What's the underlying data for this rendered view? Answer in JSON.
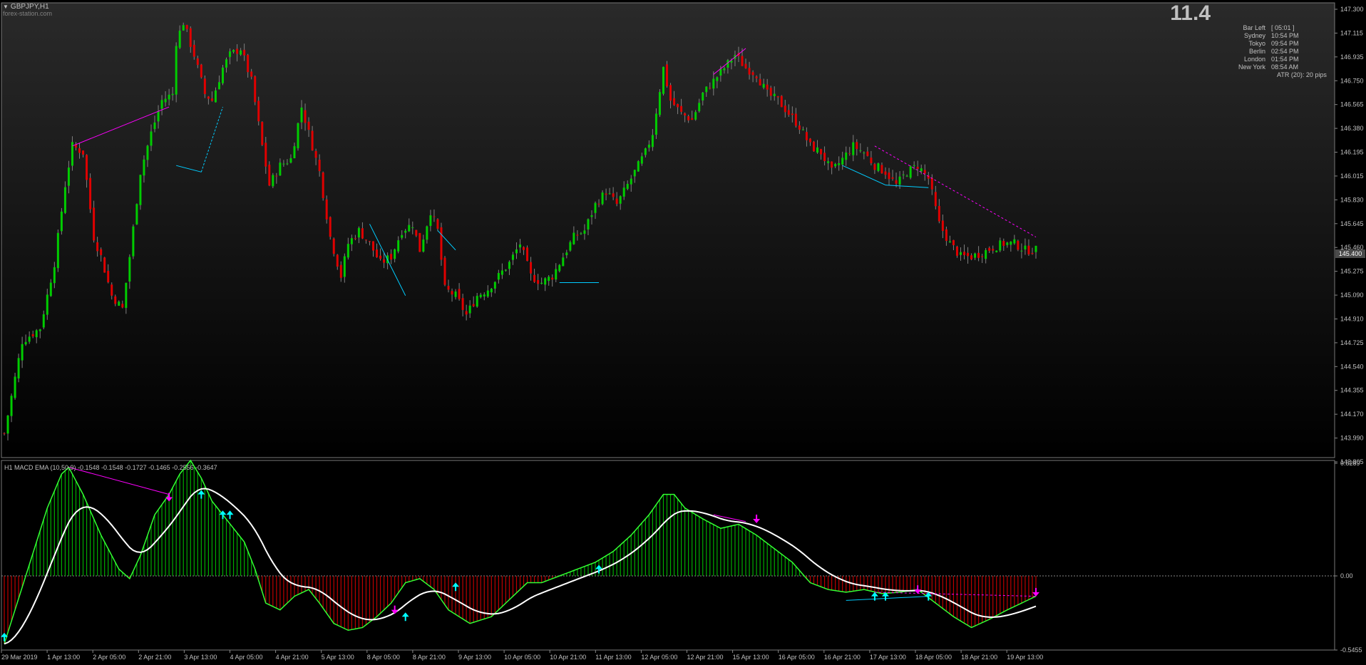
{
  "header": {
    "symbol": "GBPJPY,H1",
    "watermark": "forex-station.com",
    "dropdown_icon": "triangle-down-icon"
  },
  "timer": {
    "big_value": "11.4",
    "rows": [
      {
        "name": "Bar Left",
        "time": "[ 05:01 ]"
      },
      {
        "name": "Sydney",
        "time": "10:54 PM"
      },
      {
        "name": "Tokyo",
        "time": "09:54 PM"
      },
      {
        "name": "Berlin",
        "time": "02:54 PM"
      },
      {
        "name": "London",
        "time": "01:54 PM"
      },
      {
        "name": "New York",
        "time": "08:54 AM"
      }
    ],
    "atr": "ATR (20): 20 pips"
  },
  "price_axis": {
    "ticks": [
      "147.300",
      "147.115",
      "146.935",
      "146.750",
      "146.565",
      "146.380",
      "146.195",
      "146.015",
      "145.830",
      "145.645",
      "145.460",
      "145.275",
      "145.090",
      "144.910",
      "144.725",
      "144.540",
      "144.355",
      "144.170",
      "143.990",
      "143.805"
    ],
    "current_price": "145.400"
  },
  "macd": {
    "label": "H1 MACD EMA (10,50,9) -0.1548 -0.1548 -0.1727 -0.1465 -0.2556 -0.3647",
    "axis_ticks": [
      "0.8289",
      "0.00",
      "-0.5455"
    ]
  },
  "time_axis": {
    "labels": [
      "29 Mar 2019",
      "1 Apr 13:00",
      "2 Apr 05:00",
      "2 Apr 21:00",
      "3 Apr 13:00",
      "4 Apr 05:00",
      "4 Apr 21:00",
      "5 Apr 13:00",
      "8 Apr 05:00",
      "8 Apr 21:00",
      "9 Apr 13:00",
      "10 Apr 05:00",
      "10 Apr 21:00",
      "11 Apr 13:00",
      "12 Apr 05:00",
      "12 Apr 21:00",
      "15 Apr 13:00",
      "16 Apr 05:00",
      "16 Apr 21:00",
      "17 Apr 13:00",
      "18 Apr 05:00",
      "18 Apr 21:00",
      "19 Apr 13:00"
    ]
  },
  "colors": {
    "background": "#000000",
    "bull": "#00cc00",
    "bear": "#e00000",
    "wick": "#808080",
    "macd_line": "#ffffff",
    "divergence_bear": "#ff00ff",
    "divergence_bull": "#00ccff",
    "arrow_up": "#00ffff",
    "arrow_down": "#ff00ff"
  },
  "chart_data": {
    "type": "candlestick",
    "symbol": "GBPJPY",
    "timeframe": "H1",
    "ylim": [
      143.805,
      147.3
    ],
    "close_path": [
      [
        0,
        143.99
      ],
      [
        5,
        144.7
      ],
      [
        10,
        144.8
      ],
      [
        14,
        145.3
      ],
      [
        17,
        145.9
      ],
      [
        19,
        146.2
      ],
      [
        22,
        146.15
      ],
      [
        25,
        145.5
      ],
      [
        27,
        145.35
      ],
      [
        30,
        145.05
      ],
      [
        33,
        144.95
      ],
      [
        35,
        145.35
      ],
      [
        38,
        146.0
      ],
      [
        41,
        146.3
      ],
      [
        44,
        146.55
      ],
      [
        47,
        146.6
      ],
      [
        48,
        147.0
      ],
      [
        50,
        147.15
      ],
      [
        53,
        146.9
      ],
      [
        56,
        146.6
      ],
      [
        58,
        146.55
      ],
      [
        61,
        146.8
      ],
      [
        63,
        146.9
      ],
      [
        66,
        146.95
      ],
      [
        69,
        146.7
      ],
      [
        72,
        146.2
      ],
      [
        74,
        145.9
      ],
      [
        77,
        146.05
      ],
      [
        80,
        146.1
      ],
      [
        83,
        146.5
      ],
      [
        85,
        146.3
      ],
      [
        88,
        146.0
      ],
      [
        91,
        145.5
      ],
      [
        94,
        145.2
      ],
      [
        96,
        145.45
      ],
      [
        99,
        145.55
      ],
      [
        102,
        145.45
      ],
      [
        105,
        145.3
      ],
      [
        108,
        145.35
      ],
      [
        111,
        145.55
      ],
      [
        114,
        145.6
      ],
      [
        116,
        145.4
      ],
      [
        119,
        145.7
      ],
      [
        121,
        145.55
      ],
      [
        123,
        145.1
      ],
      [
        126,
        145.05
      ],
      [
        129,
        144.9
      ],
      [
        132,
        145.05
      ],
      [
        135,
        145.1
      ],
      [
        138,
        145.2
      ],
      [
        141,
        145.3
      ],
      [
        144,
        145.45
      ],
      [
        147,
        145.2
      ],
      [
        150,
        145.15
      ],
      [
        153,
        145.2
      ],
      [
        156,
        145.35
      ],
      [
        159,
        145.5
      ],
      [
        162,
        145.55
      ],
      [
        165,
        145.75
      ],
      [
        168,
        145.85
      ],
      [
        171,
        145.75
      ],
      [
        174,
        145.9
      ],
      [
        176,
        146.0
      ],
      [
        179,
        146.15
      ],
      [
        181,
        146.3
      ],
      [
        184,
        146.8
      ],
      [
        186,
        146.55
      ],
      [
        189,
        146.45
      ],
      [
        192,
        146.4
      ],
      [
        195,
        146.6
      ],
      [
        198,
        146.7
      ],
      [
        201,
        146.8
      ],
      [
        204,
        146.9
      ],
      [
        207,
        146.8
      ],
      [
        210,
        146.75
      ],
      [
        213,
        146.6
      ],
      [
        216,
        146.55
      ],
      [
        219,
        146.45
      ],
      [
        222,
        146.35
      ],
      [
        225,
        146.2
      ],
      [
        228,
        146.15
      ],
      [
        231,
        146.0
      ],
      [
        234,
        146.1
      ],
      [
        237,
        146.2
      ],
      [
        240,
        146.15
      ],
      [
        243,
        146.05
      ],
      [
        246,
        146.0
      ],
      [
        249,
        145.9
      ],
      [
        252,
        146.0
      ],
      [
        255,
        146.05
      ],
      [
        258,
        145.95
      ],
      [
        261,
        145.6
      ],
      [
        264,
        145.45
      ],
      [
        267,
        145.35
      ],
      [
        270,
        145.35
      ],
      [
        273,
        145.38
      ],
      [
        276,
        145.42
      ],
      [
        279,
        145.45
      ],
      [
        282,
        145.45
      ],
      [
        285,
        145.4
      ],
      [
        288,
        145.4
      ]
    ],
    "macd_path": [
      [
        0,
        -0.5
      ],
      [
        6,
        0.0
      ],
      [
        12,
        0.5
      ],
      [
        16,
        0.75
      ],
      [
        18,
        0.8
      ],
      [
        22,
        0.6
      ],
      [
        27,
        0.3
      ],
      [
        32,
        0.05
      ],
      [
        35,
        -0.02
      ],
      [
        38,
        0.15
      ],
      [
        42,
        0.45
      ],
      [
        46,
        0.6
      ],
      [
        49,
        0.75
      ],
      [
        52,
        0.85
      ],
      [
        55,
        0.72
      ],
      [
        58,
        0.55
      ],
      [
        61,
        0.45
      ],
      [
        64,
        0.35
      ],
      [
        67,
        0.25
      ],
      [
        70,
        0.05
      ],
      [
        73,
        -0.2
      ],
      [
        77,
        -0.25
      ],
      [
        81,
        -0.15
      ],
      [
        85,
        -0.1
      ],
      [
        88,
        -0.2
      ],
      [
        92,
        -0.35
      ],
      [
        96,
        -0.4
      ],
      [
        100,
        -0.38
      ],
      [
        104,
        -0.3
      ],
      [
        108,
        -0.2
      ],
      [
        112,
        -0.05
      ],
      [
        116,
        -0.02
      ],
      [
        120,
        -0.1
      ],
      [
        124,
        -0.25
      ],
      [
        130,
        -0.35
      ],
      [
        136,
        -0.3
      ],
      [
        142,
        -0.15
      ],
      [
        146,
        -0.05
      ],
      [
        150,
        -0.05
      ],
      [
        155,
        0.0
      ],
      [
        160,
        0.05
      ],
      [
        165,
        0.1
      ],
      [
        170,
        0.18
      ],
      [
        175,
        0.3
      ],
      [
        180,
        0.45
      ],
      [
        184,
        0.6
      ],
      [
        187,
        0.6
      ],
      [
        190,
        0.5
      ],
      [
        195,
        0.42
      ],
      [
        200,
        0.35
      ],
      [
        205,
        0.38
      ],
      [
        210,
        0.3
      ],
      [
        215,
        0.2
      ],
      [
        220,
        0.1
      ],
      [
        225,
        -0.05
      ],
      [
        230,
        -0.1
      ],
      [
        235,
        -0.12
      ],
      [
        240,
        -0.1
      ],
      [
        245,
        -0.13
      ],
      [
        250,
        -0.12
      ],
      [
        255,
        -0.1
      ],
      [
        260,
        -0.2
      ],
      [
        265,
        -0.3
      ],
      [
        270,
        -0.38
      ],
      [
        275,
        -0.32
      ],
      [
        280,
        -0.25
      ],
      [
        288,
        -0.15
      ]
    ]
  }
}
